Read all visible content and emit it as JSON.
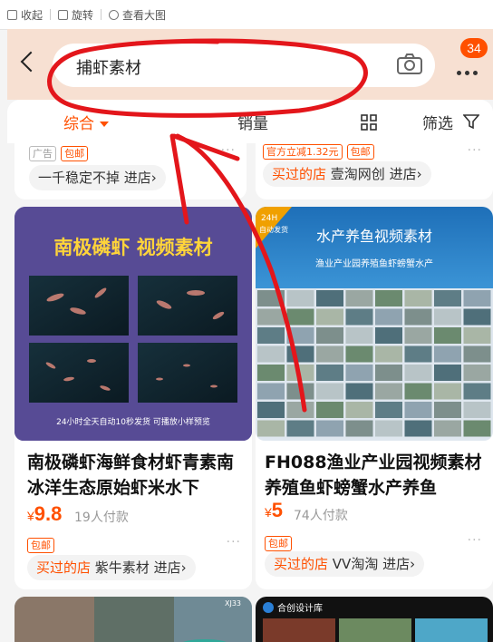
{
  "browser_bar": {
    "collect": "收起",
    "rotate": "旋转",
    "view_large": "查看大图"
  },
  "header": {
    "search_query": "捕虾素材",
    "notif_count": "34",
    "accent": "#ff5000"
  },
  "sort": {
    "comprehensive": "综合",
    "sales": "销量",
    "filter": "筛选"
  },
  "top_partial": {
    "left": {
      "tag1": "广告",
      "tag2": "包邮",
      "shop": "一千稳定不掉 进店›"
    },
    "right": {
      "promo": "官方立减1.32元",
      "tag": "包邮",
      "bought": "买过的店",
      "shop_name": "壹淘网创 进店›"
    }
  },
  "products": [
    {
      "banner_title": "南极磷虾 视频素材",
      "banner_footer": "24小时全天自动10秒发货 可播放小样预览",
      "title": "南极磷虾海鲜食材虾青素南冰洋生态原始虾米水下",
      "price_symbol": "¥",
      "price": "9.8",
      "sold": "19人付款",
      "tag": "包邮",
      "bought": "买过的店",
      "shop": "紫牛素材 进店›"
    },
    {
      "corner_badge_line1": "24H",
      "corner_badge_line2": "自动发货",
      "banner_title": "水产养鱼视频素材",
      "banner_sub": "渔业产业园养殖鱼虾螃蟹水产",
      "title": "FH088渔业产业园视频素材养殖鱼虾螃蟹水产养鱼",
      "price_symbol": "¥",
      "price": "5",
      "sold": "74人付款",
      "tag": "包邮",
      "bought": "买过的店",
      "shop": "VV淘淘 进店›"
    }
  ],
  "bottom_partial": {
    "left_mark": "XJ33",
    "right_mark": "合创设计库"
  }
}
